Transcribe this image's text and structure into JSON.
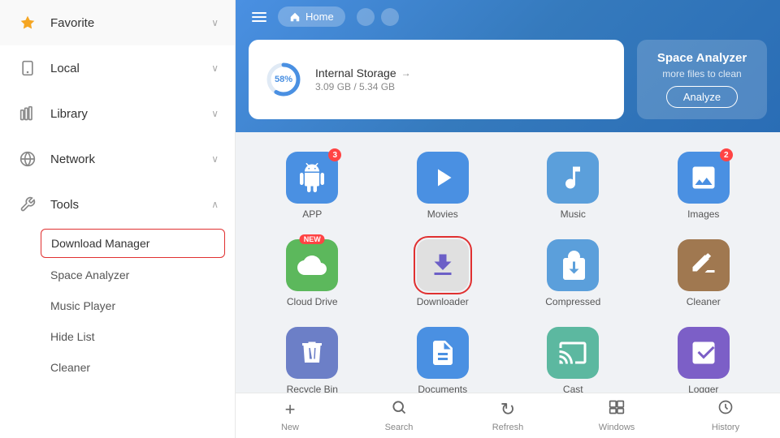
{
  "sidebar": {
    "items": [
      {
        "id": "favorite",
        "label": "Favorite",
        "icon": "★",
        "hasChevron": true,
        "chevronDown": true
      },
      {
        "id": "local",
        "label": "Local",
        "icon": "📱",
        "hasChevron": true,
        "chevronDown": true
      },
      {
        "id": "library",
        "label": "Library",
        "icon": "📚",
        "hasChevron": true,
        "chevronDown": true
      },
      {
        "id": "network",
        "label": "Network",
        "icon": "🌐",
        "hasChevron": true,
        "chevronDown": true
      },
      {
        "id": "tools",
        "label": "Tools",
        "icon": "🔧",
        "hasChevron": true,
        "chevronUp": true
      }
    ],
    "subItems": [
      {
        "id": "download-manager",
        "label": "Download Manager",
        "active": true
      },
      {
        "id": "space-analyzer",
        "label": "Space Analyzer",
        "active": false
      },
      {
        "id": "music-player",
        "label": "Music Player",
        "active": false
      },
      {
        "id": "hide-list",
        "label": "Hide List",
        "active": false
      },
      {
        "id": "cleaner",
        "label": "Cleaner",
        "active": false
      }
    ]
  },
  "header": {
    "homeLabel": "Home",
    "storageName": "Internal Storage",
    "storageUsed": "3.09 GB / 5.34 GB",
    "storagePercent": "58%",
    "storagePercentNum": 58,
    "spaceAnalyzerTitle": "Space Analyzer",
    "spaceAnalyzerSubtitle": "more files to clean",
    "analyzeBtn": "Analyze"
  },
  "grid": {
    "items": [
      {
        "id": "app",
        "label": "APP",
        "color": "#4a90e2",
        "badge": "3",
        "icon": "android"
      },
      {
        "id": "movies",
        "label": "Movies",
        "color": "#4a90e2",
        "badge": "",
        "icon": "play"
      },
      {
        "id": "music",
        "label": "Music",
        "color": "#5b9fdb",
        "badge": "",
        "icon": "music"
      },
      {
        "id": "images",
        "label": "Images",
        "color": "#4a90e2",
        "badge": "2",
        "icon": "images"
      },
      {
        "id": "cloud-drive",
        "label": "Cloud Drive",
        "color": "#5cb85c",
        "badge": "NEW",
        "icon": "cloud"
      },
      {
        "id": "downloader",
        "label": "Downloader",
        "color": "#6c5fc7",
        "badge": "",
        "icon": "download",
        "selected": true,
        "dimmed": true
      },
      {
        "id": "compressed",
        "label": "Compressed",
        "color": "#5b9fdb",
        "badge": "",
        "icon": "compress"
      },
      {
        "id": "cleaner",
        "label": "Cleaner",
        "color": "#a07850",
        "badge": "",
        "icon": "broom"
      },
      {
        "id": "recycle-bin",
        "label": "Recycle Bin",
        "color": "#6c7fc7",
        "badge": "",
        "icon": "trash"
      },
      {
        "id": "documents",
        "label": "Documents",
        "color": "#4a90e2",
        "badge": "",
        "icon": "doc"
      },
      {
        "id": "cast",
        "label": "Cast",
        "color": "#5cb8a0",
        "badge": "",
        "icon": "cast"
      },
      {
        "id": "logger",
        "label": "Logger",
        "color": "#7c5fc7",
        "badge": "",
        "icon": "logger"
      }
    ]
  },
  "bottomBar": {
    "items": [
      {
        "id": "new",
        "label": "New",
        "icon": "+"
      },
      {
        "id": "search",
        "label": "Search",
        "icon": "🔍"
      },
      {
        "id": "refresh",
        "label": "Refresh",
        "icon": "↻"
      },
      {
        "id": "windows",
        "label": "Windows",
        "icon": "⧉"
      },
      {
        "id": "history",
        "label": "History",
        "icon": "🕐"
      }
    ]
  }
}
